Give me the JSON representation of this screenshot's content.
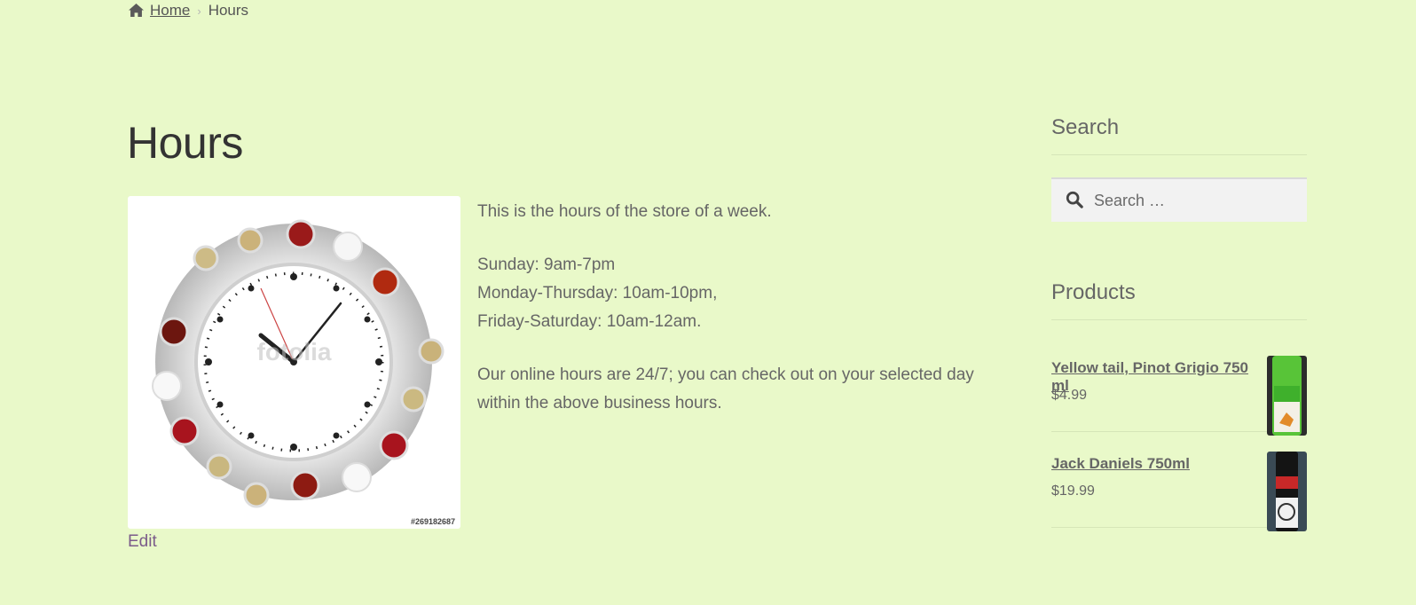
{
  "breadcrumb": {
    "home_label": "Home",
    "current_label": "Hours"
  },
  "page": {
    "title": "Hours",
    "edit_label": "Edit",
    "image_id": "#269182687",
    "image_watermark": "fotolia"
  },
  "content": {
    "intro": "This is the hours of the store of a week.",
    "hours": [
      "Sunday: 9am-7pm",
      "Monday-Thursday: 10am-10pm,",
      "Friday-Saturday: 10am-12am."
    ],
    "online_note": "Our online hours are 24/7; you can check out on your selected day within the above business hours."
  },
  "sidebar": {
    "search_title": "Search",
    "search_placeholder": "Search …",
    "products_title": "Products",
    "products": [
      {
        "name": "Yellow tail, Pinot Grigio 750 ml",
        "price": "$4.99"
      },
      {
        "name": "Jack Daniels 750ml",
        "price": "$19.99"
      }
    ]
  },
  "colors": {
    "background": "#e9f9c9",
    "edit_link": "#7b5c8a",
    "title": "#333333"
  }
}
